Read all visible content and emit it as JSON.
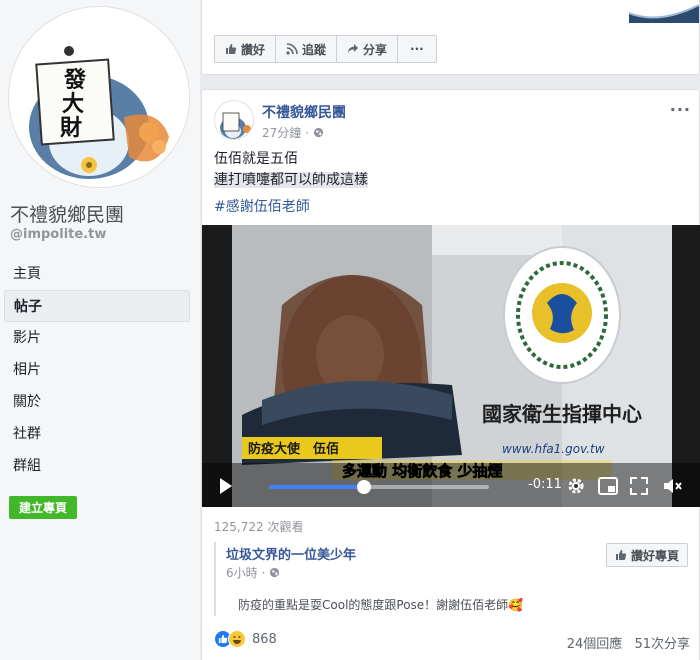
{
  "page": {
    "name": "不禮貌鄉民團",
    "handle": "@impolite.tw",
    "avatar_text": [
      "發",
      "大",
      "財"
    ]
  },
  "nav": {
    "items": [
      {
        "label": "主頁",
        "active": false
      },
      {
        "label": "帖子",
        "active": true
      },
      {
        "label": "影片",
        "active": false
      },
      {
        "label": "相片",
        "active": false
      },
      {
        "label": "關於",
        "active": false
      },
      {
        "label": "社群",
        "active": false
      },
      {
        "label": "群組",
        "active": false
      }
    ],
    "create_page_label": "建立專頁"
  },
  "top_post_actions": {
    "like_label": "讚好",
    "follow_label": "追蹤",
    "share_label": "分享",
    "more_label": "···"
  },
  "post": {
    "author": "不禮貌鄉民團",
    "time": "27分鐘",
    "more_label": "···",
    "text_line1": "伍佰就是五佰",
    "text_line2": "連打噴嚏都可以帥成這樣",
    "hashtag": "#感謝伍佰老師",
    "video": {
      "caption_name": "防疫大使　伍佰",
      "caption_slogan": "多運動 均衡飲食 少抽煙",
      "sign_text": "國家衛生指揮中心",
      "url_text": "www.hfa1.gov.tw",
      "time_remaining": "-0:11",
      "progress": 0.43
    },
    "views": "125,722 次觀看",
    "comment": {
      "author": "垃圾文界的一位美少年",
      "time": "6小時",
      "like_page_label": "讚好專頁",
      "text": "防疫的重點是耍Cool的態度跟Pose！謝謝伍佰老師🥰"
    },
    "reaction_count": "868",
    "comments_count": "24個回應",
    "shares_count": "51次分享"
  },
  "colors": {
    "link": "#365899",
    "green": "#42b72a",
    "progress": "#4080ff"
  }
}
